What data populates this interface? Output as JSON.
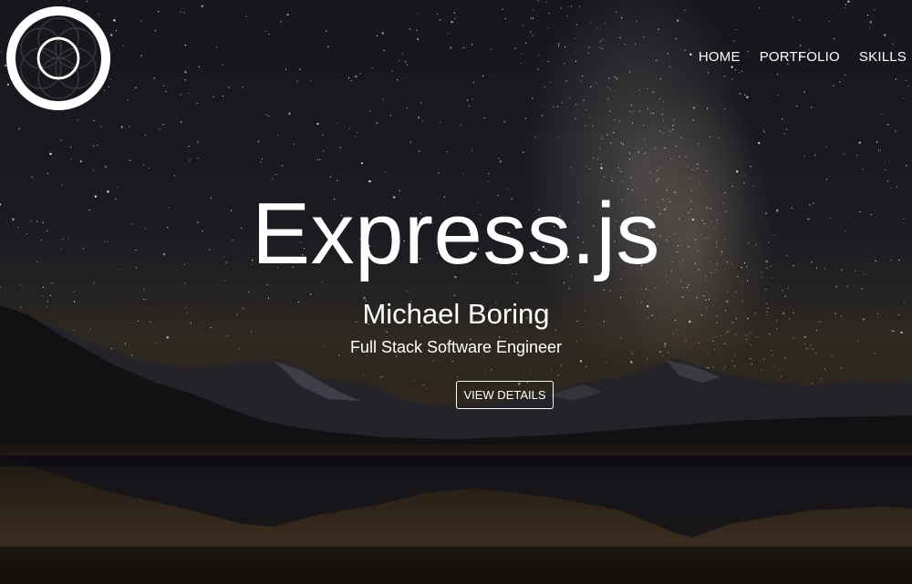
{
  "brand": {
    "logo_icon": "flower-of-life-icon"
  },
  "nav": {
    "items": [
      {
        "label": "HOME"
      },
      {
        "label": "PORTFOLIO"
      },
      {
        "label": "SKILLS"
      }
    ]
  },
  "hero": {
    "title": "Express.js",
    "name": "Michael Boring",
    "role": "Full Stack Software Engineer",
    "cta_label": "VIEW DETAILS"
  },
  "colors": {
    "text": "#ffffff",
    "sky": "#15171d",
    "mountains": "#1b1a1c",
    "water_glow": "#7a6040"
  }
}
